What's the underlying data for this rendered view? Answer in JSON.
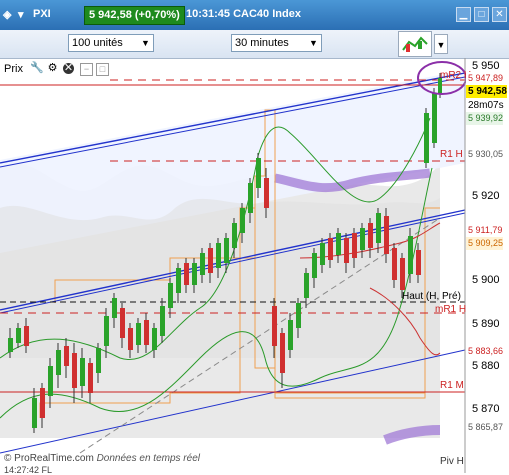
{
  "window": {
    "instrument": "PXI",
    "price_change": "5 942,58 (+0,70%)",
    "time_title": "10:31:45 CAC40 Index",
    "colors": {
      "titlebar": "#3b86c9",
      "badge": "#1e8a1e"
    }
  },
  "toolbar": {
    "units_value": "100 unités",
    "timeframe_value": "30 minutes",
    "chart_type_icon": "candlestick-chart-icon",
    "dropdown_icon": "chevron-down-icon"
  },
  "panel": {
    "title": "Prix",
    "icons": [
      "wrench-icon",
      "close-icon",
      "settings-icon",
      "maximize-icon"
    ]
  },
  "axis": {
    "ticks": [
      "5 950",
      "5 920",
      "5 900",
      "5 890",
      "5 880",
      "5 870"
    ]
  },
  "price_boxes": {
    "top_value": "5 947,89",
    "current_price": "5 942,58",
    "countdown": "28m07s",
    "value_939": "5 939,92",
    "value_930": "5 930,05",
    "value_911": "5 911,79",
    "value_909": "5 909,25",
    "value_883": "5 883,66",
    "value_865": "5 865,87"
  },
  "annotations": {
    "mr2": "mR2 H",
    "r1h": "R1 H",
    "high_pre": "Haut (H, Pré)",
    "mr1": "mR1 H",
    "r1m": "R1 M",
    "piv": "Piv H"
  },
  "footer": {
    "brand": "© ProRealTime.com",
    "live": "Données en temps réel"
  },
  "bottom_hint": "14:27:42 FL"
}
